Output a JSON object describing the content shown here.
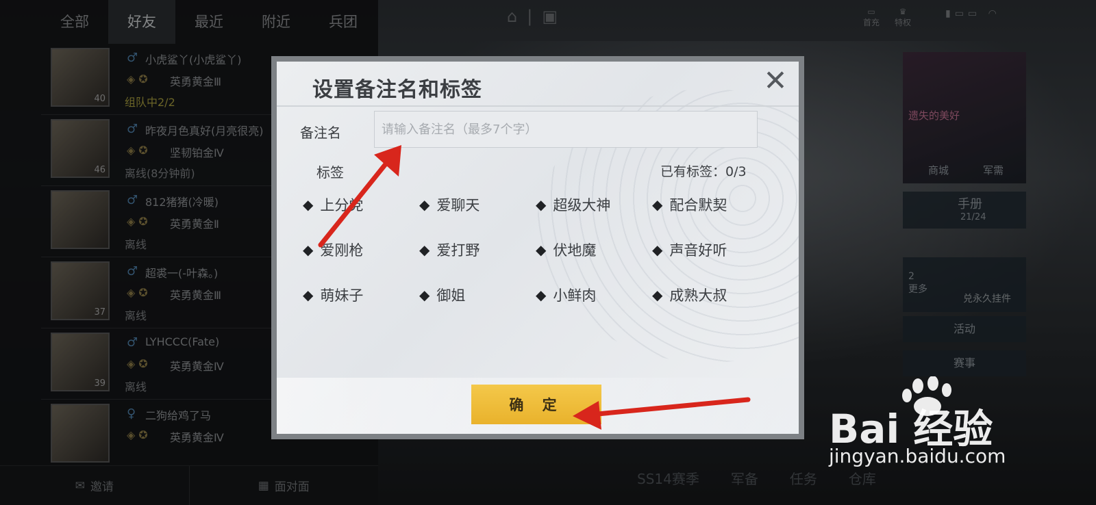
{
  "tabs": [
    "全部",
    "好友",
    "最近",
    "附近",
    "兵团"
  ],
  "friends": [
    {
      "name": "小虎鲨丫(小虎鲨丫)",
      "rank": "英勇黄金Ⅲ",
      "status": "组队中2/2",
      "level": "40",
      "status_color": "#a59b3d"
    },
    {
      "name": "昨夜月色真好(月亮很亮)",
      "rank": "坚韧铂金Ⅳ",
      "status": "离线(8分钟前)",
      "level": "46"
    },
    {
      "name": "812猪猪(冷暖)",
      "rank": "英勇黄金Ⅱ",
      "status": "离线",
      "level": ""
    },
    {
      "name": "超裘一(-叶森。)",
      "rank": "英勇黄金Ⅲ",
      "status": "离线",
      "level": "37"
    },
    {
      "name": "LYHCCC(Fate)",
      "rank": "英勇黄金Ⅳ",
      "status": "离线",
      "level": "39"
    },
    {
      "name": "二狗给鸡了马",
      "rank": "英勇黄金Ⅳ",
      "status": "",
      "level": ""
    }
  ],
  "bottom_bar": {
    "invite": "邀请",
    "face": "面对面"
  },
  "top_right": {
    "first_charge": "首充",
    "privilege": "特权"
  },
  "right_menu": {
    "skin_title": "遗失的美好",
    "shop": "商城",
    "military": "军需",
    "handbook": "手册",
    "handbook_progress": "21/24",
    "more": "更多",
    "more_count": "2",
    "pendant": "兑永久挂件",
    "activity": "活动",
    "events": "赛事"
  },
  "bottom_nav": [
    "SS14赛季",
    "军备",
    "任务",
    "仓库"
  ],
  "dialog": {
    "title": "设置备注名和标签",
    "remark_label": "备注名",
    "remark_placeholder": "请输入备注名（最多7个字）",
    "remark_value": "",
    "tags_label": "标签",
    "tags_count": "已有标签：0/3",
    "tags": [
      "上分党",
      "爱聊天",
      "超级大神",
      "配合默契",
      "爱刚枪",
      "爱打野",
      "伏地魔",
      "声音好听",
      "萌妹子",
      "御姐",
      "小鲜肉",
      "成熟大叔"
    ],
    "confirm": "确 定"
  },
  "watermark": {
    "logo": "Bai  经验",
    "url": "jingyan.baidu.com"
  },
  "colors": {
    "accent_yellow": "#f4c84a",
    "arrow_red": "#d8261c",
    "team_status": "#a59b3d"
  }
}
